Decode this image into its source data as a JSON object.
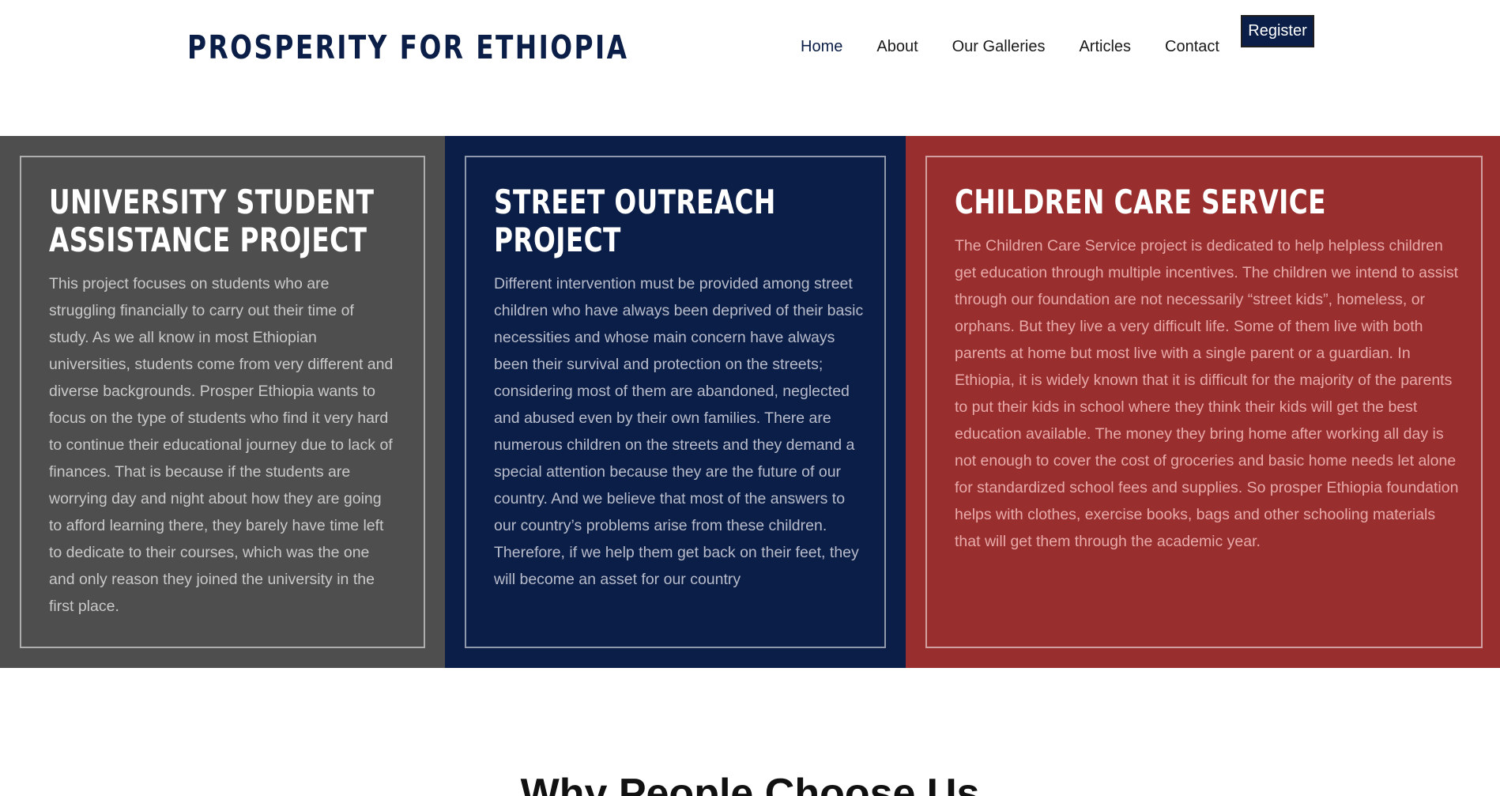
{
  "header": {
    "logo_text": "PROSPERITY FOR ETHIOPIA",
    "nav": [
      {
        "label": "Home"
      },
      {
        "label": "About"
      },
      {
        "label": "Our Galleries"
      },
      {
        "label": "Articles"
      },
      {
        "label": "Contact"
      }
    ],
    "register_label": "Register"
  },
  "colors": {
    "brand_navy": "#0b1e47",
    "panel_gray": "#4e4e4e",
    "panel_red": "#992e2e"
  },
  "panels": [
    {
      "title": "UNIVERSITY STUDENT ASSISTANCE PROJECT",
      "body": "This project focuses on students who are struggling financially to carry out their time of study. As we all know in most Ethiopian universities, students come from very different and diverse backgrounds. Prosper Ethiopia wants to focus on the type of students who find it very hard to continue their educational journey due to lack of finances. That is because if the students are worrying day and night about how they are going to afford learning there, they barely have time left to dedicate to their courses, which was the one and only reason they joined the university in the first place."
    },
    {
      "title": "STREET OUTREACH PROJECT",
      "body": "Different intervention must be provided among street children who have always been deprived of their basic necessities and whose main concern have always been their survival and protection on the streets; considering most of them are abandoned, neglected and abused even by their own families. There are numerous children on the streets and they demand a special attention because they are the future of our country. And we believe that most of the answers to our country’s problems arise from these children. Therefore, if we help them get back on their feet, they will become an asset for our country"
    },
    {
      "title": "CHILDREN CARE SERVICE",
      "body": "The Children Care Service project is dedicated to help helpless children get education through multiple incentives. The children we intend to assist through our foundation are not necessarily “street kids”, homeless, or orphans. But they live a very difficult life. Some of them live with both parents at home but most live with a single parent or a guardian. In Ethiopia, it is widely known that it is difficult for the majority of the parents to put their kids in school where they think their kids will get the best education available. The money they bring home after working all day is not enough to cover the cost of groceries and basic home needs let alone for standardized school fees and supplies. So prosper Ethiopia foundation helps with clothes, exercise books, bags and other schooling materials that will get them through the academic year."
    }
  ],
  "why_section": {
    "heading": "Why People Choose Us"
  }
}
